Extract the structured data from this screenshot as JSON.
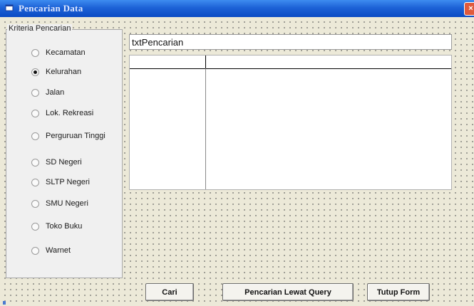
{
  "window": {
    "title": "Pencarian Data",
    "close_label": "×"
  },
  "criteria": {
    "caption": "Kriteria Pencarian",
    "options": [
      {
        "label": "Kecamatan",
        "checked": false
      },
      {
        "label": "Kelurahan",
        "checked": true
      },
      {
        "label": "Jalan",
        "checked": false
      },
      {
        "label": "Lok. Rekreasi",
        "checked": false
      },
      {
        "label": "Perguruan Tinggi",
        "checked": false
      },
      {
        "label": "SD Negeri",
        "checked": false
      },
      {
        "label": "SLTP Negeri",
        "checked": false
      },
      {
        "label": "SMU Negeri",
        "checked": false
      },
      {
        "label": "Toko Buku",
        "checked": false
      },
      {
        "label": "Warnet",
        "checked": false
      }
    ]
  },
  "search": {
    "value": "txtPencarian"
  },
  "buttons": {
    "cari": "Cari",
    "query": "Pencarian Lewat Query",
    "tutup": "Tutup Form"
  },
  "colors": {
    "titlebar": "#1d62d6",
    "form_bg": "#ece9d8"
  }
}
